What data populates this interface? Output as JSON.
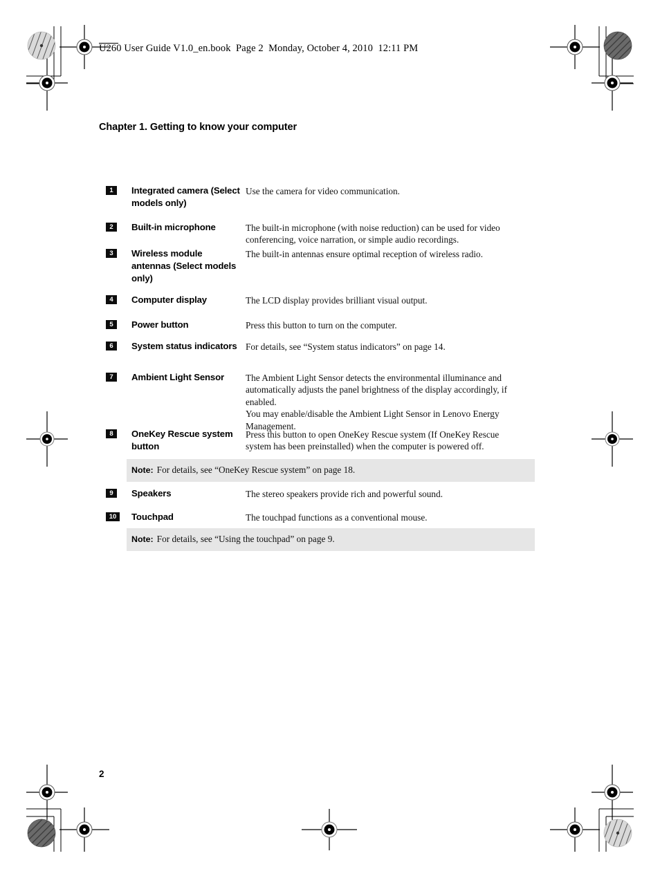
{
  "document": {
    "running_header": "U260 User Guide V1.0_en.book  Page 2  Monday, October 4, 2010  12:11 PM",
    "chapter_title": "Chapter 1. Getting to know your computer",
    "page_number": "2"
  },
  "items": [
    {
      "number": "1",
      "label": "Integrated camera (Select models only)",
      "description": "Use the camera for video communication."
    },
    {
      "number": "2",
      "label": "Built-in microphone",
      "description": "The built-in microphone (with noise reduction) can be used for video conferencing, voice narration, or simple audio recordings."
    },
    {
      "number": "3",
      "label": "Wireless module antennas (Select models only)",
      "description": "The built-in antennas ensure optimal reception of wireless radio."
    },
    {
      "number": "4",
      "label": "Computer display",
      "description": "The LCD display provides brilliant visual output."
    },
    {
      "number": "5",
      "label": "Power button",
      "description": "Press this button to turn on the computer."
    },
    {
      "number": "6",
      "label": "System status indicators",
      "description": "For details, see “System status indicators” on page 14."
    },
    {
      "number": "7",
      "label": "Ambient Light Sensor",
      "description": "The Ambient Light Sensor detects the environmental illuminance and automatically adjusts the panel brightness of the display accordingly, if enabled.\nYou may enable/disable the Ambient Light Sensor in Lenovo Energy Management."
    },
    {
      "number": "8",
      "label": "OneKey Rescue system button",
      "description": "Press this button to open OneKey Rescue system (If OneKey Rescue system has been preinstalled) when the computer is powered off."
    },
    {
      "number": "9",
      "label": "Speakers",
      "description": "The stereo speakers provide rich and powerful sound."
    },
    {
      "number": "10",
      "label": "Touchpad",
      "description": "The touchpad functions as a conventional mouse."
    }
  ],
  "notes": [
    {
      "label": "Note:",
      "text": "For details, see “OneKey Rescue system” on page 18."
    },
    {
      "label": "Note:",
      "text": "For details, see “Using the touchpad” on page 9."
    }
  ],
  "colors": {
    "badge_background": "#0d0d0d",
    "badge_text": "#ffffff",
    "note_background": "#e6e6e6",
    "body_text": "#111111",
    "page_background": "#ffffff"
  }
}
